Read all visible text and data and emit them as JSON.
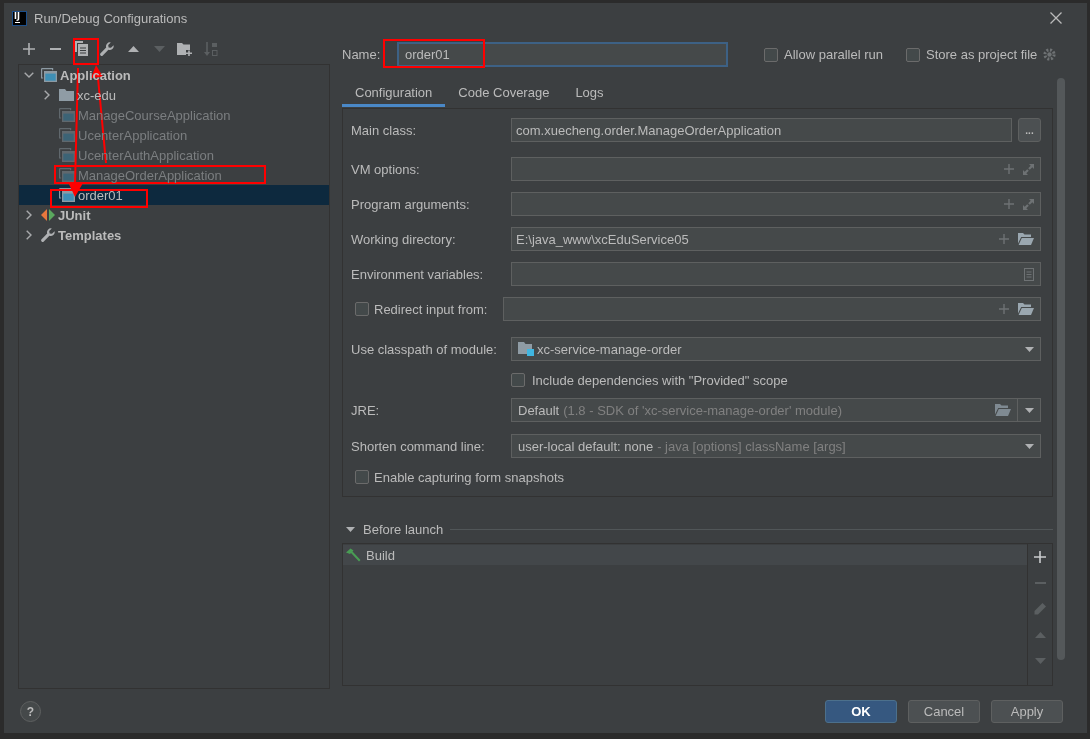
{
  "window": {
    "logo": "IJ",
    "title": "Run/Debug Configurations"
  },
  "toolbar": [
    {
      "kind": "add",
      "disabled": false
    },
    {
      "kind": "remove",
      "disabled": false
    },
    {
      "kind": "copy",
      "disabled": false
    },
    {
      "kind": "settings",
      "disabled": false
    },
    {
      "kind": "up",
      "disabled": false
    },
    {
      "kind": "down",
      "disabled": true
    },
    {
      "kind": "folder",
      "disabled": false
    },
    {
      "kind": "sort",
      "disabled": true
    }
  ],
  "tree": [
    {
      "label": "Application",
      "kind": "type",
      "expanded": true,
      "selected": false,
      "temporary": false,
      "children": [
        {
          "label": "xc-edu",
          "kind": "folder",
          "expanded": false,
          "selected": false,
          "temporary": false
        },
        {
          "label": "ManageCourseApplication",
          "kind": "config",
          "selected": false,
          "temporary": true
        },
        {
          "label": "UcenterApplication",
          "kind": "config",
          "selected": false,
          "temporary": true
        },
        {
          "label": "UcenterAuthApplication",
          "kind": "config",
          "selected": false,
          "temporary": true
        },
        {
          "label": "ManageOrderApplication",
          "kind": "config",
          "selected": false,
          "temporary": true
        },
        {
          "label": "order01",
          "kind": "config",
          "selected": true,
          "temporary": false
        }
      ]
    },
    {
      "label": "JUnit",
      "kind": "junit",
      "expanded": false,
      "selected": false,
      "temporary": false
    },
    {
      "label": "Templates",
      "kind": "templates",
      "expanded": false,
      "selected": false,
      "temporary": false
    }
  ],
  "name": {
    "label": "Name:",
    "value": "order01",
    "focused": true
  },
  "options": [
    {
      "label": "Allow parallel run",
      "checked": false
    },
    {
      "label": "Store as project file",
      "checked": false
    }
  ],
  "tabs": [
    {
      "label": "Configuration",
      "selected": true
    },
    {
      "label": "Code Coverage",
      "selected": false
    },
    {
      "label": "Logs",
      "selected": false
    }
  ],
  "form": [
    {
      "kind": "class",
      "label": "Main class:",
      "value": "com.xuecheng.order.ManageOrderApplication",
      "browse": "..."
    },
    {
      "kind": "expandable",
      "label": "VM options:"
    },
    {
      "kind": "expandable",
      "label": "Program arguments:"
    },
    {
      "kind": "directory",
      "label": "Working directory:",
      "value": "E:\\java_www\\xcEduService05"
    },
    {
      "kind": "env",
      "label": "Environment variables:"
    },
    {
      "kind": "redirect",
      "label": "Redirect input from:",
      "checked": false
    },
    {
      "kind": "module",
      "label": "Use classpath of module:",
      "value": "xc-service-manage-order"
    },
    {
      "kind": "sub-checkbox",
      "label": "Include dependencies with \"Provided\" scope",
      "checked": false
    },
    {
      "kind": "jre",
      "label": "JRE:",
      "value": "Default",
      "detail": "(1.8 - SDK of 'xc-service-manage-order' module)"
    },
    {
      "kind": "combo",
      "label": "Shorten command line:",
      "value": "user-local default: none",
      "detail": "- java [options] className [args]"
    },
    {
      "kind": "checkbox",
      "label": "Enable capturing form snapshots",
      "checked": false
    }
  ],
  "before_launch": {
    "title": "Before launch",
    "expanded": true,
    "tasks": [
      {
        "label": "Build",
        "selected": true
      }
    ],
    "tools": [
      {
        "kind": "add",
        "disabled": false
      },
      {
        "kind": "remove",
        "disabled": true
      },
      {
        "kind": "edit",
        "disabled": true
      },
      {
        "kind": "up",
        "disabled": true
      },
      {
        "kind": "down",
        "disabled": true
      }
    ]
  },
  "footer": {
    "help": "?",
    "buttons": [
      {
        "label": "OK",
        "kind": "default"
      },
      {
        "label": "Cancel",
        "kind": "normal"
      },
      {
        "label": "Apply",
        "kind": "normal"
      }
    ]
  }
}
